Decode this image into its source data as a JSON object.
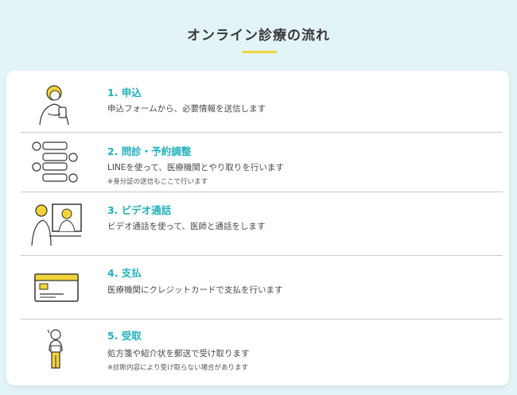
{
  "page": {
    "title": "オンライン診療の流れ"
  },
  "steps": [
    {
      "title": "1. 申込",
      "desc": "申込フォームから、必要情報を送信します",
      "note": "",
      "icon": "person-with-phone-icon"
    },
    {
      "title": "2. 問診・予約調整",
      "desc": "LINEを使って、医療機関とやり取りを行います",
      "note": "※身分証の送信もここで行います",
      "icon": "chat-messages-icon"
    },
    {
      "title": "3. ビデオ通話",
      "desc": "ビデオ通話を使って、医師と通話をします",
      "note": "",
      "icon": "video-call-icon"
    },
    {
      "title": "4. 支払",
      "desc": "医療機関にクレジットカードで支払を行います",
      "note": "",
      "icon": "credit-card-icon"
    },
    {
      "title": "5. 受取",
      "desc": "処方箋や紹介状を郵送で受け取ります",
      "note": "※診断内容により受け取らない場合があります",
      "icon": "receiving-person-icon"
    }
  ],
  "colors": {
    "accent": "#1fb0bd",
    "underline": "#f2d43a",
    "background": "#e3f4f6"
  }
}
